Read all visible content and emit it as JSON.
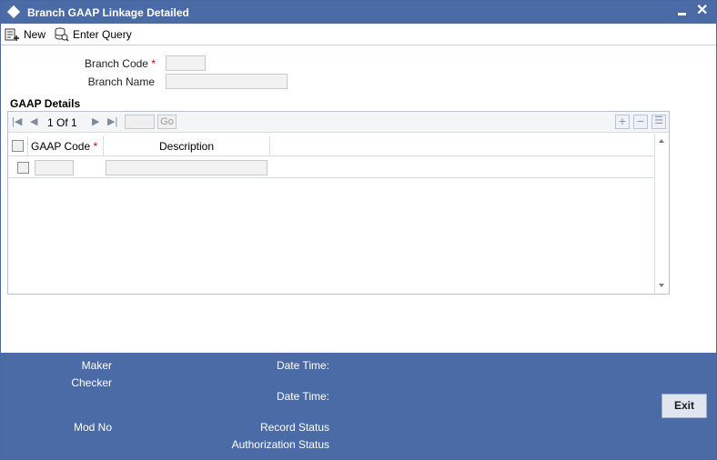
{
  "window": {
    "title": "Branch GAAP Linkage Detailed"
  },
  "toolbar": {
    "new_label": "New",
    "enter_query_label": "Enter Query"
  },
  "form": {
    "branch_code_label": "Branch Code",
    "branch_code_required": "*",
    "branch_code_value": "",
    "branch_name_label": "Branch Name",
    "branch_name_value": ""
  },
  "gaap": {
    "section_title": "GAAP Details",
    "pager": {
      "current": "1",
      "of_label": "Of",
      "total": "1",
      "go_label": "Go",
      "page_input": ""
    },
    "columns": [
      {
        "label": "GAAP Code",
        "required": "*"
      },
      {
        "label": "Description"
      }
    ],
    "rows": [
      {
        "gaap_code": "",
        "description": ""
      }
    ]
  },
  "footer": {
    "maker_label": "Maker",
    "checker_label": "Checker",
    "date_time_label": "Date Time:",
    "mod_no_label": "Mod No",
    "record_status_label": "Record Status",
    "authorization_status_label": "Authorization Status",
    "exit_label": "Exit"
  },
  "colors": {
    "title_bar": "#4b6ba6",
    "footer": "#4b6ba6",
    "required": "#cc0000"
  }
}
